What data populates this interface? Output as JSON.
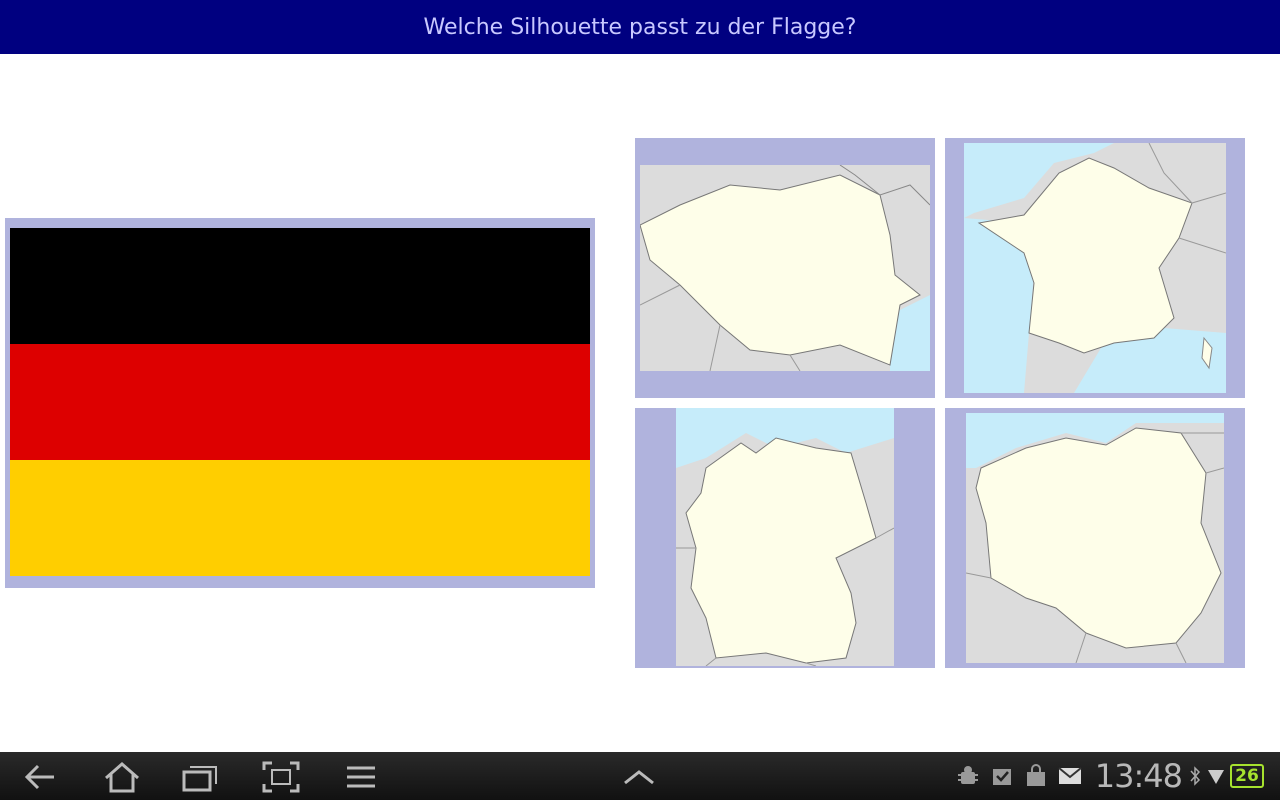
{
  "header": {
    "title": "Welche Silhouette passt zu der Flagge?"
  },
  "flag": {
    "country": "Germany",
    "stripe_colors": [
      "#000000",
      "#dd0000",
      "#ffce00"
    ]
  },
  "answers": [
    {
      "country": "Romania",
      "icon": "romania-silhouette"
    },
    {
      "country": "France",
      "icon": "france-silhouette"
    },
    {
      "country": "Germany",
      "icon": "germany-silhouette"
    },
    {
      "country": "Poland",
      "icon": "poland-silhouette"
    }
  ],
  "colors": {
    "header_bg": "#000080",
    "header_text": "#c8c8ff",
    "frame": "#b0b3dd",
    "land": "#fefee9",
    "sea": "#c6ecfa",
    "neighbors": "#dcdcdc"
  },
  "system_bar": {
    "clock": "13:48",
    "battery": "26"
  }
}
